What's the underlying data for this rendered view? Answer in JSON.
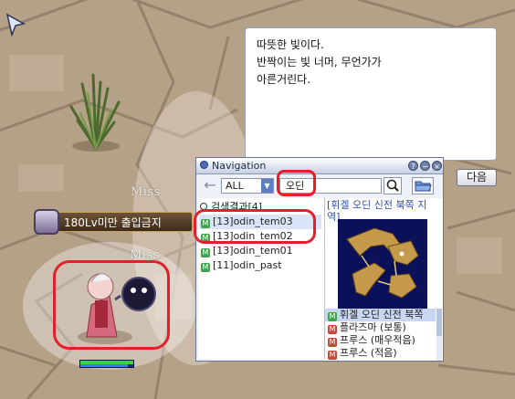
{
  "world": {
    "miss_labels": [
      "Miss",
      "Miss"
    ],
    "level_badge": "180Lv미만 출입금지"
  },
  "npc_dialog": {
    "lines": [
      "따뜻한 빛이다.",
      "반짝이는 빛 너머, 무언가가",
      "아른거린다."
    ],
    "next_button": "다음"
  },
  "navigation": {
    "title": "Navigation",
    "titlebar_buttons": [
      "?",
      "−",
      "×"
    ],
    "back_arrow": "←",
    "scope": "ALL",
    "search_value": "오딘",
    "result_count": "검색결과[4]",
    "results": [
      {
        "badge": "M",
        "text": "[13]odin_tem03",
        "selected": true
      },
      {
        "badge": "M",
        "text": "[13]odin_tem02",
        "selected": false
      },
      {
        "badge": "M",
        "text": "[13]odin_tem01",
        "selected": false
      },
      {
        "badge": "M",
        "text": "[11]odin_past",
        "selected": false
      }
    ],
    "map_title": "[휘겔 오딘 신전 북쪽 지역]",
    "map_list": [
      {
        "badge": "M",
        "color": "green",
        "text": "휘겔 오딘 신전 북쪽",
        "selected": true
      },
      {
        "badge": "M",
        "color": "red",
        "text": "플라즈마 (보통)",
        "selected": false
      },
      {
        "badge": "M",
        "color": "red",
        "text": "프루스 (매우적음)",
        "selected": false
      },
      {
        "badge": "M",
        "color": "red",
        "text": "프루스 (적음)",
        "selected": false
      }
    ]
  },
  "status": {
    "hp_fraction": 1.0,
    "sp_fraction": 0.9
  },
  "colors": {
    "highlight": "#e2202b",
    "nav_accent": "#5e7fc6"
  }
}
